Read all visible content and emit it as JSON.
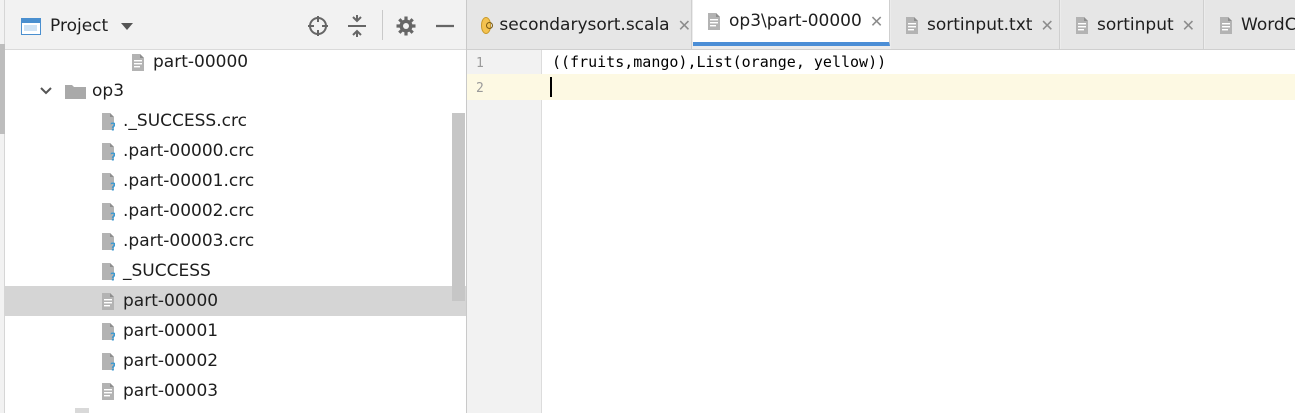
{
  "project_panel": {
    "title": "Project"
  },
  "tree": [
    {
      "label": "part-00000",
      "kind": "text-file",
      "depth": 2
    },
    {
      "label": "op3",
      "kind": "folder",
      "depth": 0,
      "expanded": true
    },
    {
      "label": "._SUCCESS.crc",
      "kind": "unknown-file",
      "depth": 1
    },
    {
      "label": ".part-00000.crc",
      "kind": "unknown-file",
      "depth": 1
    },
    {
      "label": ".part-00001.crc",
      "kind": "unknown-file",
      "depth": 1
    },
    {
      "label": ".part-00002.crc",
      "kind": "unknown-file",
      "depth": 1
    },
    {
      "label": ".part-00003.crc",
      "kind": "unknown-file",
      "depth": 1
    },
    {
      "label": "_SUCCESS",
      "kind": "unknown-file",
      "depth": 1
    },
    {
      "label": "part-00000",
      "kind": "text-file",
      "depth": 1,
      "selected": true
    },
    {
      "label": "part-00001",
      "kind": "unknown-file",
      "depth": 1
    },
    {
      "label": "part-00002",
      "kind": "unknown-file",
      "depth": 1
    },
    {
      "label": "part-00003",
      "kind": "text-file",
      "depth": 1
    }
  ],
  "tabs": [
    {
      "label": "secondarysort.scala",
      "icon": "scala-object-icon",
      "active": false
    },
    {
      "label": "op3\\part-00000",
      "icon": "text-file-icon",
      "active": true
    },
    {
      "label": "sortinput.txt",
      "icon": "text-file-icon",
      "active": false
    },
    {
      "label": "sortinput",
      "icon": "text-file-icon",
      "active": false
    },
    {
      "label": "WordC",
      "icon": "text-file-icon",
      "active": false
    }
  ],
  "editor": {
    "lines": [
      {
        "number": "1",
        "text": "((fruits,mango),List(orange, yellow))"
      },
      {
        "number": "2",
        "text": ""
      }
    ],
    "caret_line": 2
  },
  "colors": {
    "selection": "#d5d5d5",
    "active_tab_underline": "#4b8ed6",
    "caret_line": "#fdf9e3",
    "folder": "#a9a9a9",
    "unknown_file_mark": "#3d9ad1"
  }
}
